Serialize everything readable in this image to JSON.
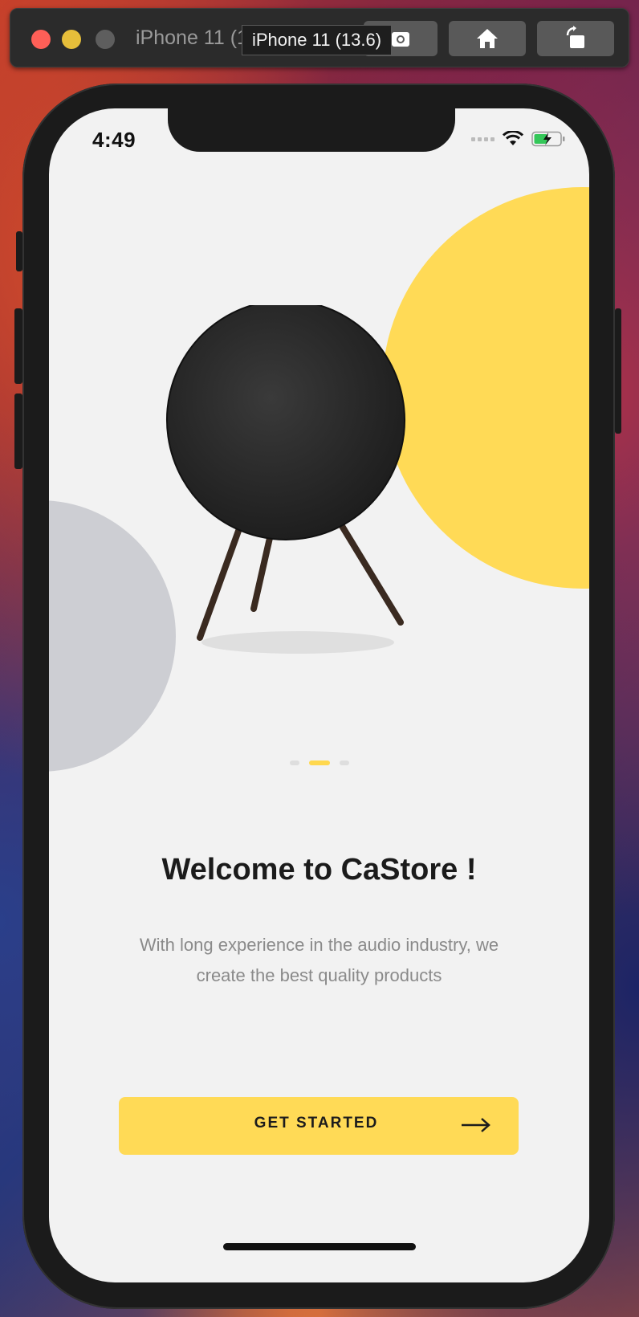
{
  "window": {
    "title": "iPhone 11 (13.6)",
    "tooltip": "iPhone 11 (13.6)",
    "toolbar_icons": [
      "screenshot-icon",
      "home-icon",
      "rotate-icon"
    ]
  },
  "status_bar": {
    "time": "4:49",
    "icons": [
      "signal-icon",
      "wifi-icon",
      "battery-charging-icon"
    ]
  },
  "onboarding": {
    "title": "Welcome to CaStore !",
    "description": "With long experience in the audio industry, we create the best quality products",
    "button_label": "GET STARTED",
    "pagination": {
      "count": 3,
      "active_index": 1
    }
  },
  "colors": {
    "accent": "#ffda56",
    "secondary_circle": "#cdced3",
    "screen_background": "#f2f2f2",
    "title_text": "#1b1b1b",
    "body_text": "#8a8a8a"
  }
}
